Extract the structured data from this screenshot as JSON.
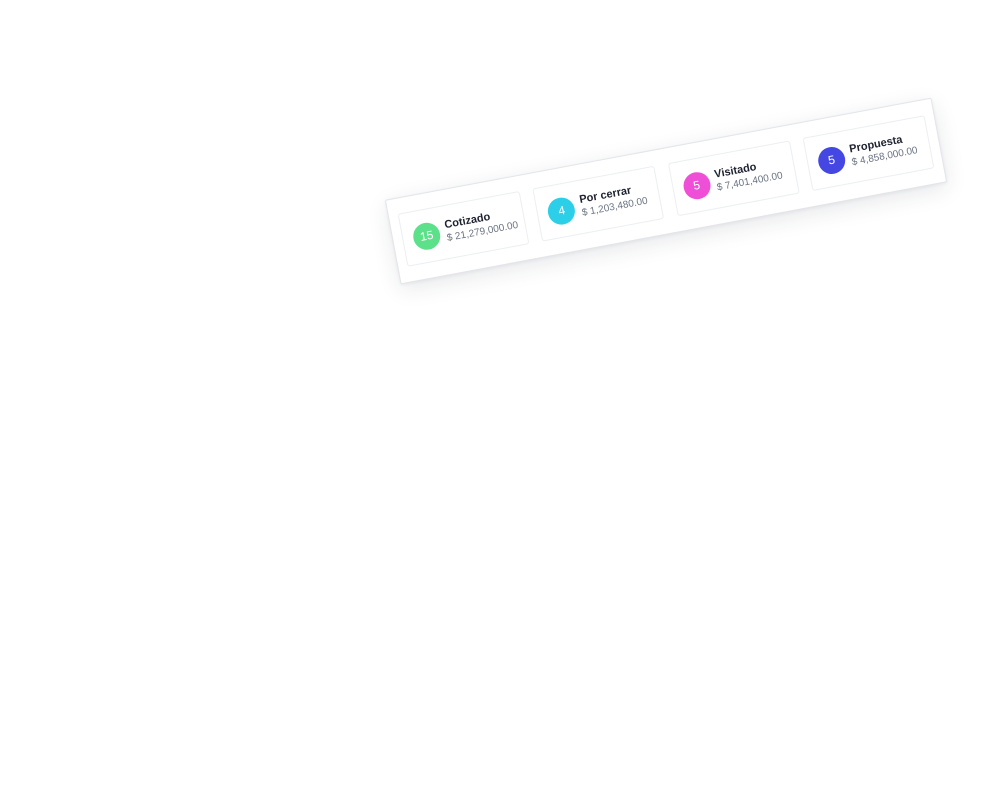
{
  "pipeline": {
    "stages": [
      {
        "count": "15",
        "label": "Cotizado",
        "amount": "$ 21,279,000.00",
        "color": "#5ce18a"
      },
      {
        "count": "4",
        "label": "Por cerrar",
        "amount": "$ 1,203,480.00",
        "color": "#2dcfe8"
      },
      {
        "count": "5",
        "label": "Visitado",
        "amount": "$ 7,401,400.00",
        "color": "#ef4fd6"
      },
      {
        "count": "5",
        "label": "Propuesta",
        "amount": "$ 4,858,000.00",
        "color": "#4447e2"
      }
    ]
  }
}
